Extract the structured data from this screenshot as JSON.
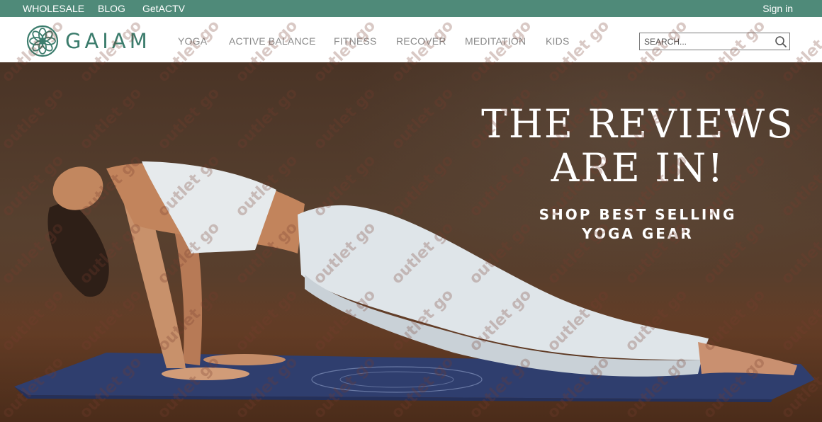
{
  "topbar": {
    "links": [
      "WHOLESALE",
      "BLOG",
      "GetACTV"
    ],
    "signin": "Sign in"
  },
  "header": {
    "brand": "GAIAM",
    "nav": [
      "YOGA",
      "ACTIVE BALANCE",
      "FITNESS",
      "RECOVER",
      "MEDITATION",
      "KIDS"
    ],
    "search_placeholder": "SEARCH..."
  },
  "hero": {
    "headline_line1": "THE REVIEWS",
    "headline_line2": "ARE IN!",
    "cta_line1": "SHOP BEST SELLING",
    "cta_line2": "YOGA GEAR"
  },
  "watermark": "outlet go",
  "colors": {
    "topbar": "#4f8a79",
    "brand": "#3b7c6c",
    "nav_text": "#8a8a8a",
    "hero_text": "#ffffff"
  },
  "icons": [
    "gaiam-flower-logo-icon",
    "search-icon"
  ]
}
